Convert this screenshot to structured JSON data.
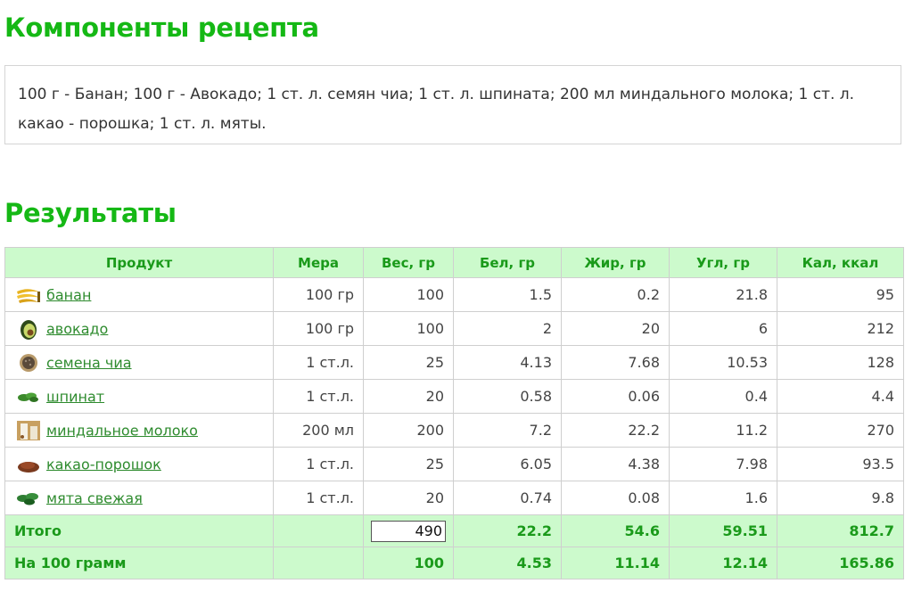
{
  "headings": {
    "components": "Компоненты рецепта",
    "results": "Результаты"
  },
  "recipe_text": "100 г - Банан; 100 г - Авокадо; 1 ст. л. семян чиа; 1 ст. л. шпината; 200 мл миндального молока; 1 ст. л. какао - порошка; 1 ст. л. мяты.",
  "table": {
    "headers": [
      "Продукт",
      "Мера",
      "Вес, гр",
      "Бел, гр",
      "Жир, гр",
      "Угл, гр",
      "Кал, ккал"
    ],
    "rows": [
      {
        "icon": "banana-icon",
        "name": "банан",
        "measure": "100 гр",
        "weight": "100",
        "protein": "1.5",
        "fat": "0.2",
        "carbs": "21.8",
        "kcal": "95"
      },
      {
        "icon": "avocado-icon",
        "name": "авокадо",
        "measure": "100 гр",
        "weight": "100",
        "protein": "2",
        "fat": "20",
        "carbs": "6",
        "kcal": "212"
      },
      {
        "icon": "chia-seeds-icon",
        "name": "семена чиа",
        "measure": "1 ст.л.",
        "weight": "25",
        "protein": "4.13",
        "fat": "7.68",
        "carbs": "10.53",
        "kcal": "128"
      },
      {
        "icon": "spinach-icon",
        "name": "шпинат",
        "measure": "1 ст.л.",
        "weight": "20",
        "protein": "0.58",
        "fat": "0.06",
        "carbs": "0.4",
        "kcal": "4.4"
      },
      {
        "icon": "almond-milk-icon",
        "name": "миндальное молоко",
        "measure": "200 мл",
        "weight": "200",
        "protein": "7.2",
        "fat": "22.2",
        "carbs": "11.2",
        "kcal": "270"
      },
      {
        "icon": "cocoa-powder-icon",
        "name": "какао-порошок",
        "measure": "1 ст.л.",
        "weight": "25",
        "protein": "6.05",
        "fat": "4.38",
        "carbs": "7.98",
        "kcal": "93.5"
      },
      {
        "icon": "mint-icon",
        "name": "мята свежая",
        "measure": "1 ст.л.",
        "weight": "20",
        "protein": "0.74",
        "fat": "0.08",
        "carbs": "1.6",
        "kcal": "9.8"
      }
    ],
    "total": {
      "label": "Итого",
      "weight": "490",
      "protein": "22.2",
      "fat": "54.6",
      "carbs": "59.51",
      "kcal": "812.7"
    },
    "per100": {
      "label": "На 100 грамм",
      "weight": "100",
      "protein": "4.53",
      "fat": "11.14",
      "carbs": "12.14",
      "kcal": "165.86"
    }
  },
  "colors": {
    "heading": "#15b815",
    "header_bg": "#ccfacc",
    "link": "#2e8b2e"
  }
}
